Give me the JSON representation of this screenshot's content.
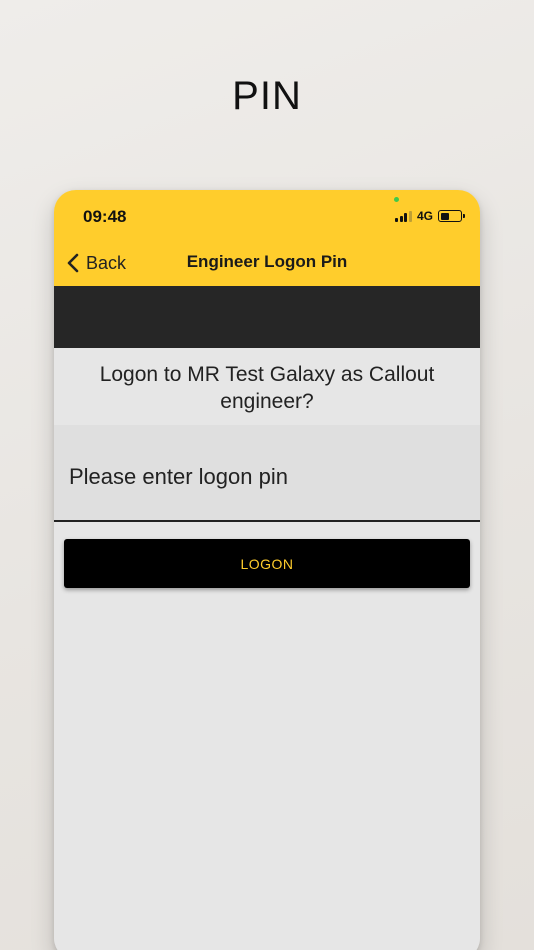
{
  "page": {
    "heading": "PIN"
  },
  "status_bar": {
    "time": "09:48",
    "network": "4G",
    "icons": [
      "signal-icon",
      "battery-icon"
    ]
  },
  "nav": {
    "back_label": "Back",
    "back_icon": "chevron-left-icon",
    "title": "Engineer Logon Pin"
  },
  "form": {
    "question": "Logon to MR Test Galaxy as Callout engineer?",
    "pin_placeholder": "Please enter logon pin",
    "pin_value": "",
    "logon_label": "LOGON"
  },
  "colors": {
    "accent": "#ffcd2c",
    "dark_bar": "#262626",
    "button": "#000000",
    "background": "#e6e6e6"
  }
}
